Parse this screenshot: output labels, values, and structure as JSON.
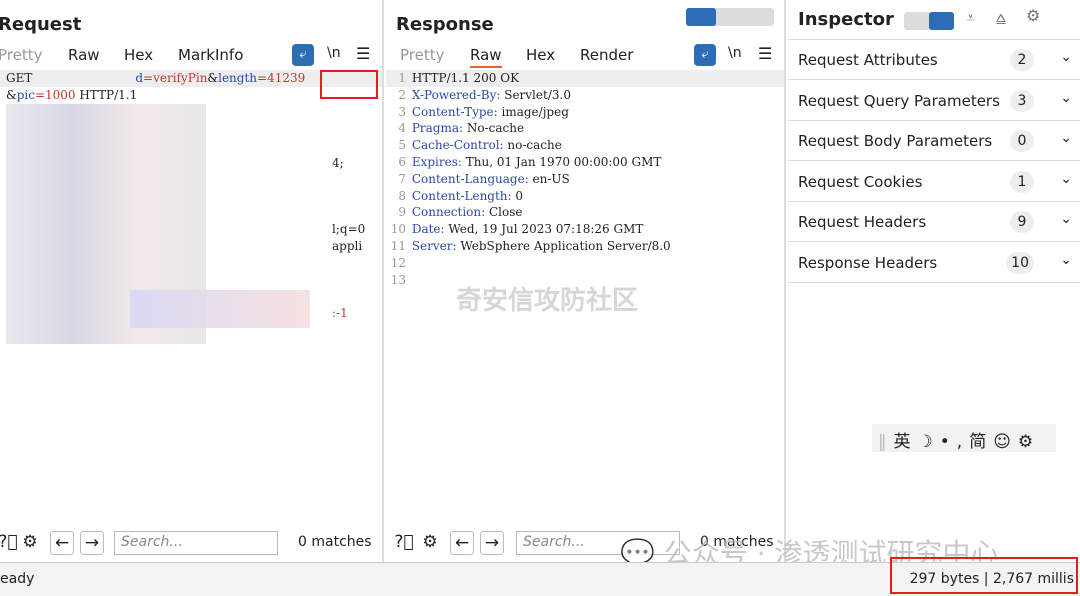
{
  "request": {
    "title": "Request",
    "tabs": [
      "Pretty",
      "Raw",
      "Hex",
      "MarkInfo"
    ],
    "newline_label": "\\n",
    "lines": [
      {
        "parts": [
          [
            "GET ",
            ""
          ],
          [
            "                          ",
            ""
          ],
          [
            "d",
            "k"
          ],
          [
            "=verifyPin",
            "v"
          ],
          [
            "&",
            ""
          ],
          [
            "length",
            "k"
          ],
          [
            "=41239",
            "v"
          ]
        ]
      },
      {
        "parts": [
          [
            "&",
            ""
          ],
          [
            "pic",
            "k"
          ],
          [
            "=1000",
            "v"
          ],
          [
            " HTTP/1.1",
            ""
          ]
        ]
      }
    ],
    "fragments": [
      "4;",
      "l;q=0",
      "appli",
      ":-1"
    ],
    "search_placeholder": "Search...",
    "matches": "0 matches"
  },
  "response": {
    "title": "Response",
    "tabs": [
      "Pretty",
      "Raw",
      "Hex",
      "Render"
    ],
    "newline_label": "\\n",
    "lines": [
      {
        "n": "1",
        "k": "",
        "v": "HTTP/1.1 200 OK"
      },
      {
        "n": "2",
        "k": "X-Powered-By:",
        "v": " Servlet/3.0"
      },
      {
        "n": "3",
        "k": "Content-Type:",
        "v": " image/jpeg"
      },
      {
        "n": "4",
        "k": "Pragma:",
        "v": " No-cache"
      },
      {
        "n": "5",
        "k": "Cache-Control:",
        "v": " no-cache"
      },
      {
        "n": "6",
        "k": "Expires:",
        "v": " Thu, 01 Jan 1970 00:00:00 GMT"
      },
      {
        "n": "7",
        "k": "Content-Language:",
        "v": " en-US"
      },
      {
        "n": "8",
        "k": "Content-Length:",
        "v": " 0"
      },
      {
        "n": "9",
        "k": "Connection:",
        "v": " Close"
      },
      {
        "n": "10",
        "k": "Date:",
        "v": " Wed, 19 Jul 2023 07:18:26 GMT"
      },
      {
        "n": "11",
        "k": "Server:",
        "v": " WebSphere Application Server/8.0"
      },
      {
        "n": "12",
        "k": "",
        "v": ""
      },
      {
        "n": "13",
        "k": "",
        "v": ""
      }
    ],
    "search_placeholder": "Search...",
    "matches": "0 matches"
  },
  "inspector": {
    "title": "Inspector",
    "sections": [
      {
        "label": "Request Attributes",
        "count": "2"
      },
      {
        "label": "Request Query Parameters",
        "count": "3"
      },
      {
        "label": "Request Body Parameters",
        "count": "0"
      },
      {
        "label": "Request Cookies",
        "count": "1"
      },
      {
        "label": "Request Headers",
        "count": "9"
      },
      {
        "label": "Response Headers",
        "count": "10"
      }
    ]
  },
  "ime_toolbar": [
    "英",
    "☽",
    "•,",
    "简",
    "☺",
    "⚙"
  ],
  "watermarks": {
    "center": "奇安信攻防社区",
    "bottom": "公众号 · 渗透测试研究中心"
  },
  "status": {
    "left": "eady",
    "right": "297 bytes | 2,767 millis"
  },
  "colors": {
    "accent": "#2d6db5",
    "tab_underline": "#e8632b",
    "highlight_box": "#e02020"
  }
}
